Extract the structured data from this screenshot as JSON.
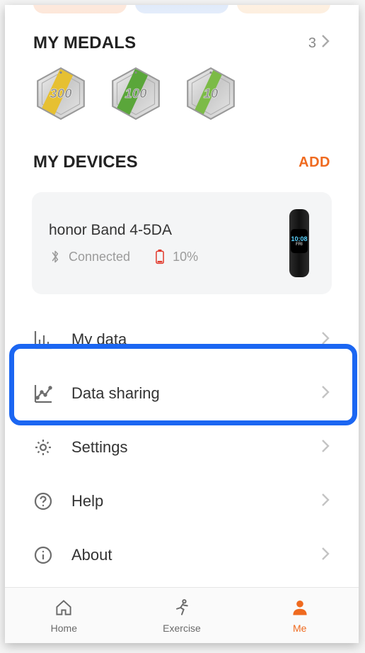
{
  "medals_section": {
    "title": "MY MEDALS",
    "count": "3",
    "medals": [
      {
        "value": "300"
      },
      {
        "value": "100"
      },
      {
        "value": "10"
      }
    ]
  },
  "devices_section": {
    "title": "MY DEVICES",
    "add_label": "ADD",
    "device": {
      "name": "honor Band 4-5DA",
      "status": "Connected",
      "battery": "10%",
      "screen_time": "10:08",
      "screen_sub": "FRI"
    }
  },
  "menu": {
    "my_data": "My data",
    "data_sharing": "Data sharing",
    "settings": "Settings",
    "help": "Help",
    "about": "About"
  },
  "tabs": {
    "home": "Home",
    "exercise": "Exercise",
    "me": "Me"
  }
}
